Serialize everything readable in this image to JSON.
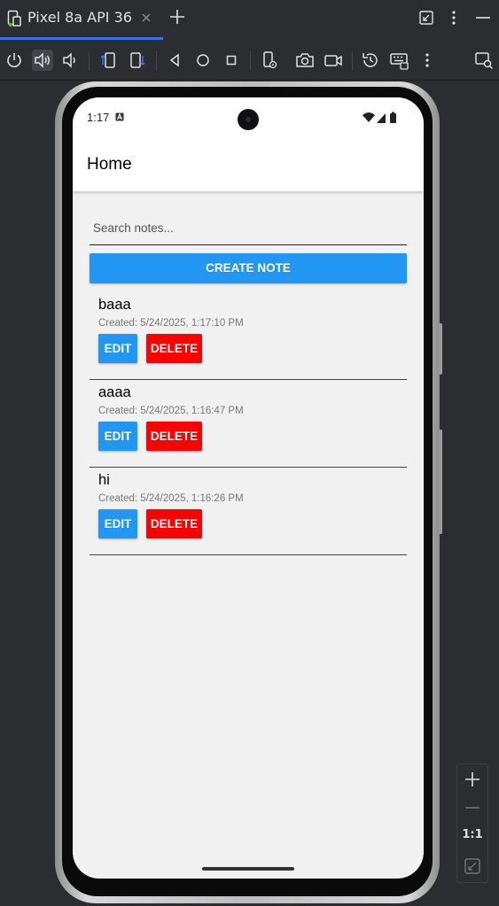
{
  "window": {
    "tab_title": "Pixel 8a API 36",
    "tab_icon": "device-icon",
    "colors": {
      "accent": "#3574f0",
      "background": "#2b2d30"
    }
  },
  "toolbar": {
    "icons": [
      "power-icon",
      "volume-up-icon",
      "volume-down-icon",
      "rotate-left-icon",
      "rotate-right-icon",
      "back-icon",
      "home-icon",
      "overview-icon",
      "device-settings-icon",
      "screenshot-icon",
      "screen-record-icon",
      "snapshot-icon",
      "keyboard-icon",
      "more-icon",
      "display-icon"
    ]
  },
  "zoom": {
    "label": "1:1"
  },
  "phone": {
    "status": {
      "time": "1:17"
    },
    "appbar": {
      "title": "Home"
    },
    "search": {
      "placeholder": "Search notes...",
      "value": ""
    },
    "create_button": "CREATE NOTE",
    "notes": [
      {
        "title": "baaa",
        "created": "Created: 5/24/2025, 1:17:10 PM",
        "edit": "EDIT",
        "delete": "DELETE"
      },
      {
        "title": "aaaa",
        "created": "Created: 5/24/2025, 1:16:47 PM",
        "edit": "EDIT",
        "delete": "DELETE"
      },
      {
        "title": "hi",
        "created": "Created: 5/24/2025, 1:16:26 PM",
        "edit": "EDIT",
        "delete": "DELETE"
      }
    ],
    "colors": {
      "primary": "#2196f3",
      "danger": "#ff0000",
      "screen_bg": "#f1f1f1"
    }
  }
}
